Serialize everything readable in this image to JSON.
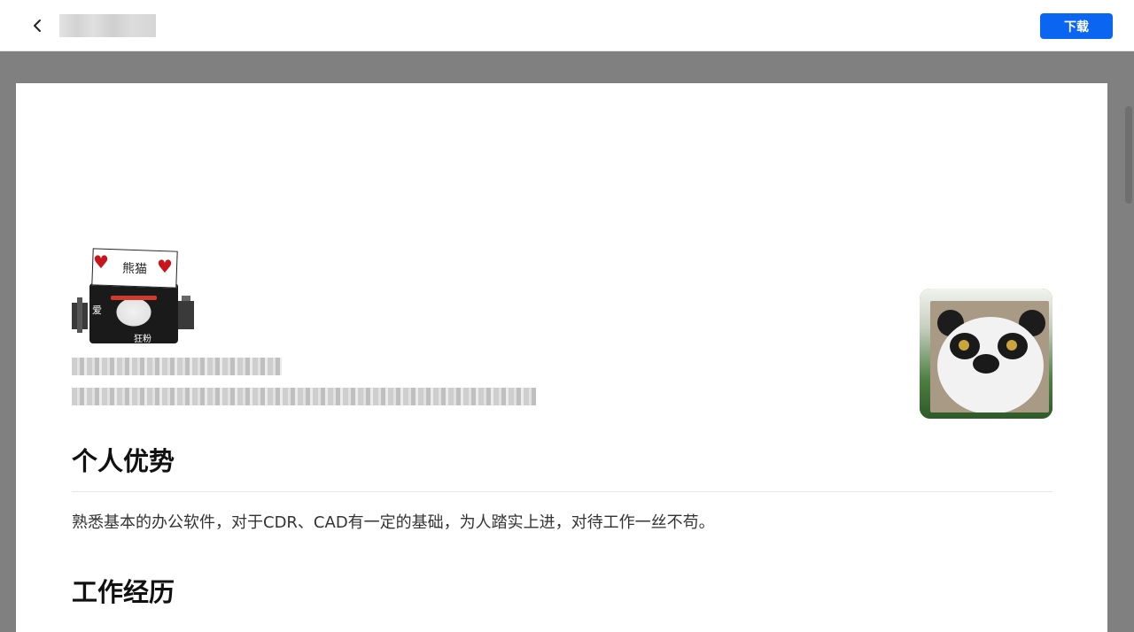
{
  "toolbar": {
    "download_label": "下载"
  },
  "sticker": {
    "sign_text": "熊猫",
    "left_text": "爱",
    "bottom_text": "狂粉"
  },
  "resume": {
    "sections": [
      {
        "title": "个人优势",
        "text": "熟悉基本的办公软件，对于CDR、CAD有一定的基础，为人踏实上进，对待工作一丝不苟。"
      },
      {
        "title": "工作经历"
      }
    ]
  },
  "icons": {
    "back": "chevron-left-icon",
    "hearts": "heart-icon"
  },
  "colors": {
    "accent": "#0a66f0",
    "viewer_bg": "#808080"
  }
}
